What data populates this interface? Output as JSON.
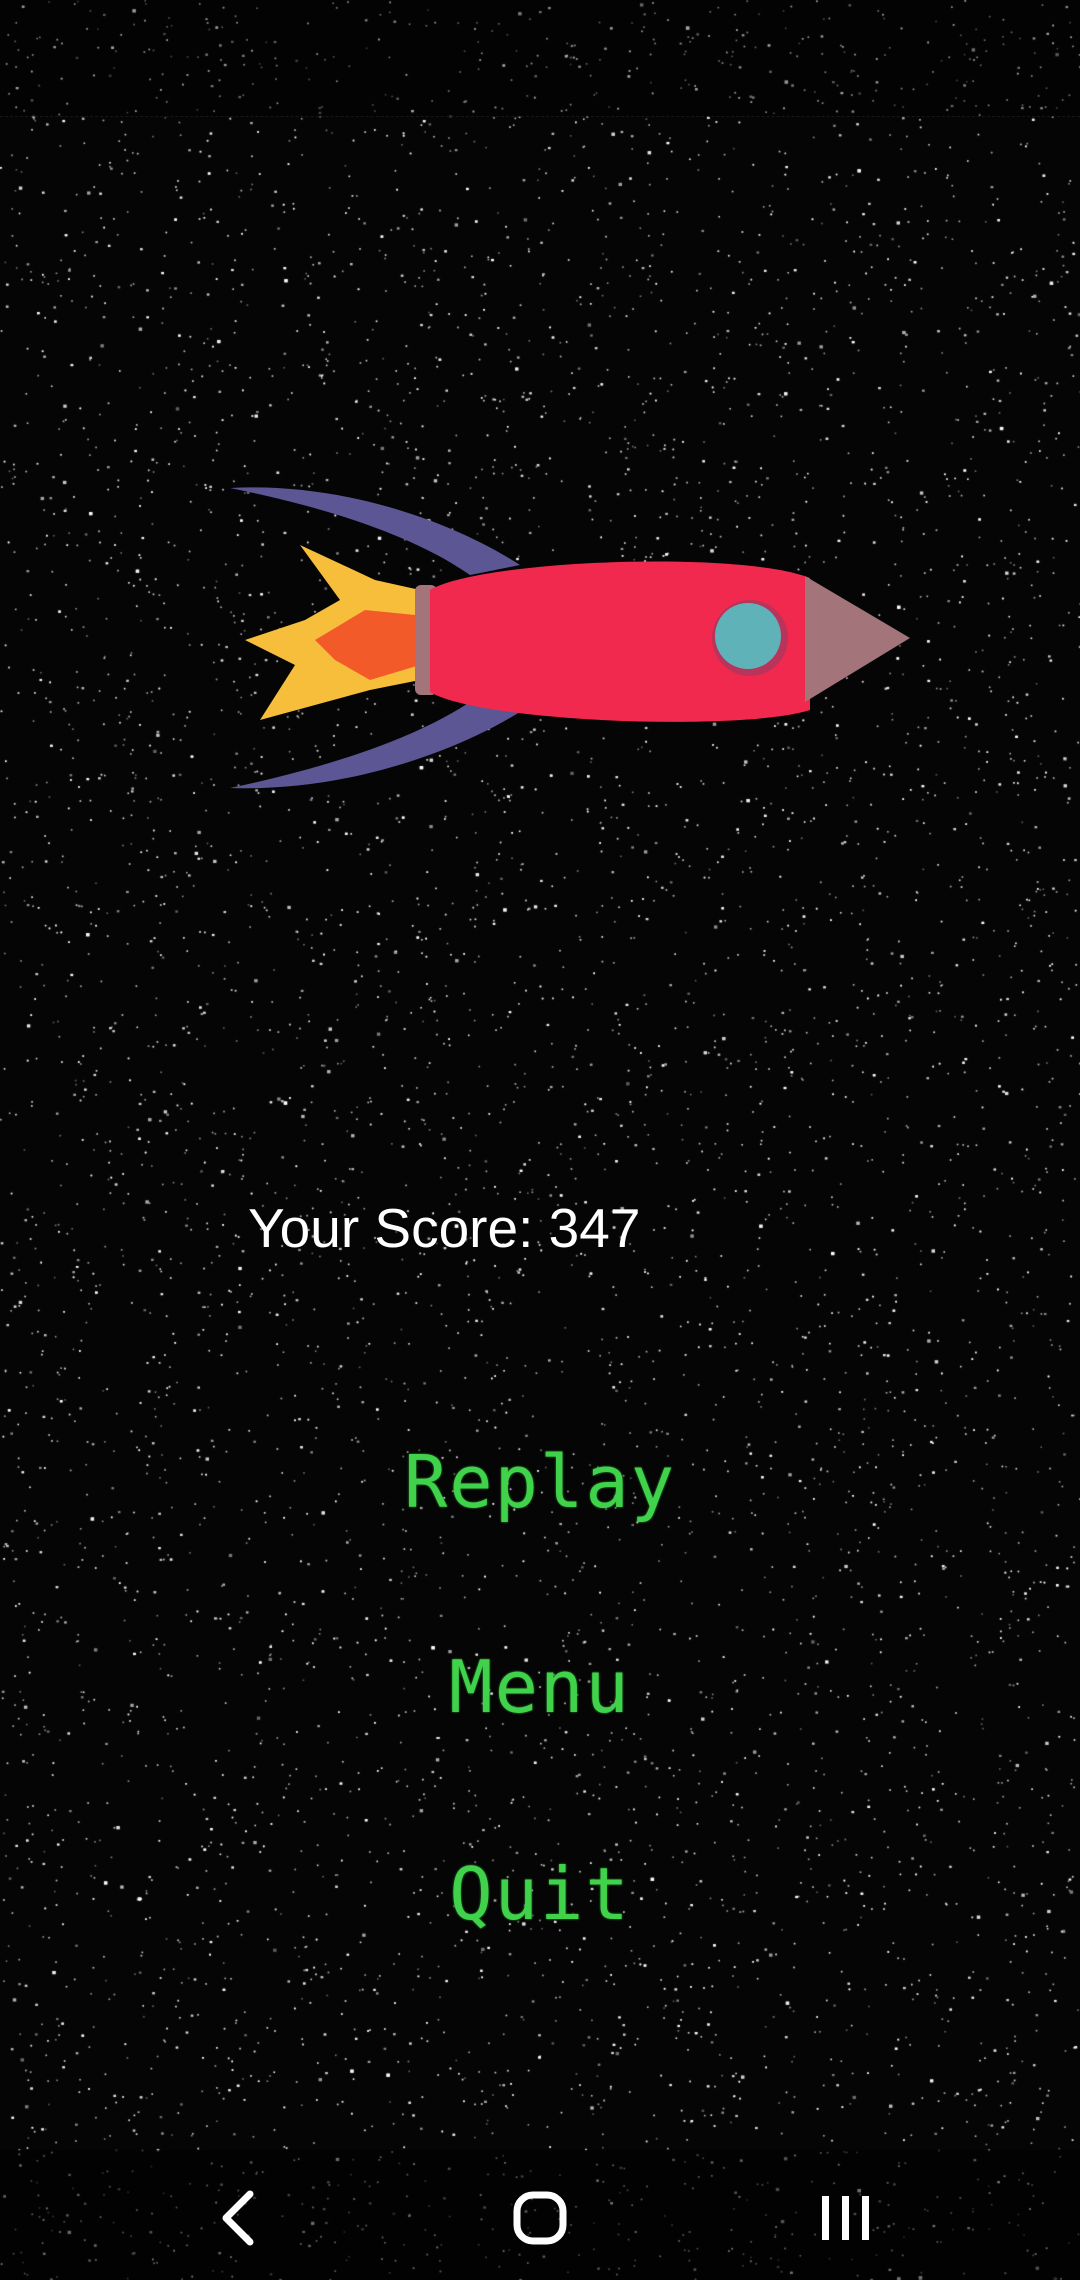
{
  "game": {
    "score_label": "Your Score: 347"
  },
  "menu": {
    "replay_label": "Replay",
    "menu_label": "Menu",
    "quit_label": "Quit"
  },
  "colors": {
    "background": "#050505",
    "button_text": "#3fd24a",
    "score_text": "#ffffff",
    "rocket_body": "#f2294f",
    "rocket_nose": "#a3747a",
    "rocket_window": "#5fb3b8",
    "rocket_fins": "#5c5694",
    "flame_outer": "#f6be3a",
    "flame_inner": "#f35a2a"
  },
  "icons": {
    "rocket": "rocket-sprite",
    "back": "chevron-left-icon",
    "home": "home-circle-icon",
    "recents": "recent-apps-icon"
  }
}
